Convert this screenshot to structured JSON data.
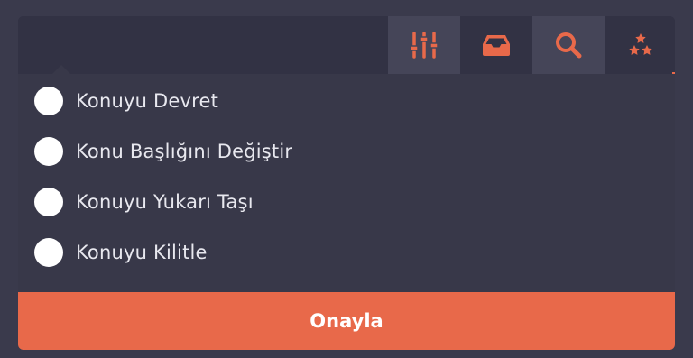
{
  "toolbar": {
    "buttons": [
      {
        "icon": "sliders-icon",
        "active": true
      },
      {
        "icon": "inbox-icon",
        "active": false
      },
      {
        "icon": "search-icon",
        "active": true
      },
      {
        "icon": "stars-icon",
        "active": false
      }
    ]
  },
  "options": [
    {
      "label": "Konuyu Devret"
    },
    {
      "label": "Konu Başlığını Değiştir"
    },
    {
      "label": "Konuyu Yukarı Taşı"
    },
    {
      "label": "Konuyu Kilitle"
    }
  ],
  "confirm_label": "Onayla",
  "colors": {
    "accent": "#e8694a",
    "background": "#3a3a4c",
    "toolbar": "#323244",
    "dropdown": "#383849",
    "active_button": "#454558",
    "text": "#e8e8ef"
  }
}
